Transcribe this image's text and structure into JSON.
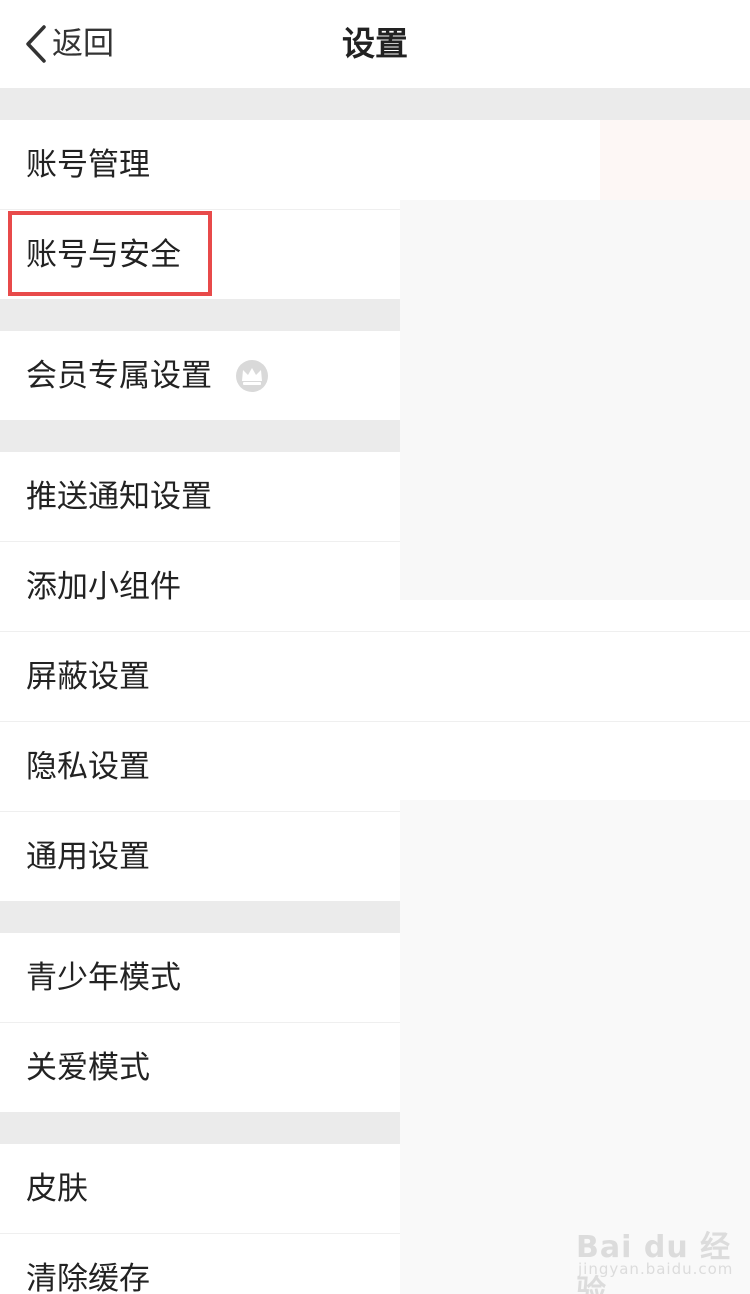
{
  "header": {
    "back_label": "返回",
    "title": "设置"
  },
  "groups": [
    {
      "items": [
        {
          "label": "账号管理"
        },
        {
          "label": "账号与安全"
        }
      ]
    },
    {
      "items": [
        {
          "label": "会员专属设置",
          "icon": "crown-icon"
        }
      ]
    },
    {
      "items": [
        {
          "label": "推送通知设置"
        },
        {
          "label": "添加小组件"
        },
        {
          "label": "屏蔽设置"
        },
        {
          "label": "隐私设置"
        },
        {
          "label": "通用设置"
        }
      ]
    },
    {
      "items": [
        {
          "label": "青少年模式"
        },
        {
          "label": "关爱模式"
        }
      ]
    },
    {
      "items": [
        {
          "label": "皮肤"
        },
        {
          "label": "清除缓存"
        }
      ]
    }
  ],
  "highlight": {
    "target": "账号与安全",
    "color": "#e84a4a"
  },
  "watermark": {
    "main": "Bai du 经验",
    "sub": "jingyan.baidu.com"
  },
  "colors": {
    "section_gap": "#ebebeb",
    "text": "#222222"
  }
}
